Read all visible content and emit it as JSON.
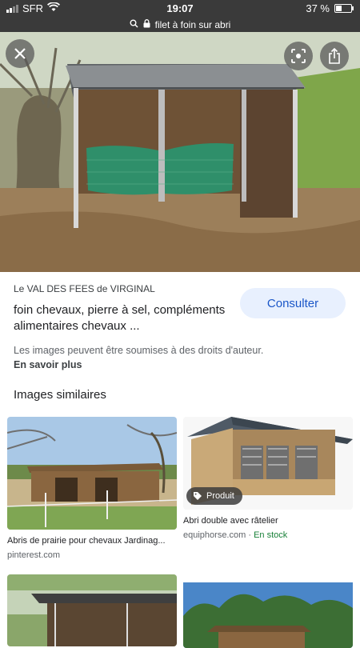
{
  "status": {
    "carrier": "SFR",
    "time": "19:07",
    "battery": "37 %",
    "battery_level": 0.37,
    "icons": [
      "signal-icon",
      "wifi-icon",
      "battery-icon"
    ]
  },
  "url_bar": {
    "text": "filet à foin sur abri",
    "icons": [
      "search-icon",
      "lock-icon"
    ]
  },
  "hero": {
    "buttons": [
      "close-icon",
      "lens-icon",
      "share-icon"
    ]
  },
  "result": {
    "source": "Le VAL DES FEES de VIRGINAL",
    "title": "foin chevaux, pierre à sel, compléments alimentaires chevaux ...",
    "consult_label": "Consulter",
    "rights_text": "Les images peuvent être soumises à des droits d'auteur.",
    "learn_more": "En savoir plus"
  },
  "similar": {
    "heading": "Images similaires",
    "items": [
      {
        "title": "Abris de prairie pour chevaux Jardinag...",
        "source": "pinterest.com"
      },
      {
        "title": "Abri double avec râtelier",
        "source": "equiphorse.com",
        "stock": "En stock",
        "badge": "Produit"
      }
    ]
  },
  "colors": {
    "accent": "#1a56c8",
    "consult_bg": "#e8f0fe",
    "instock": "#188038",
    "statusbar": "#3a3a3a"
  }
}
